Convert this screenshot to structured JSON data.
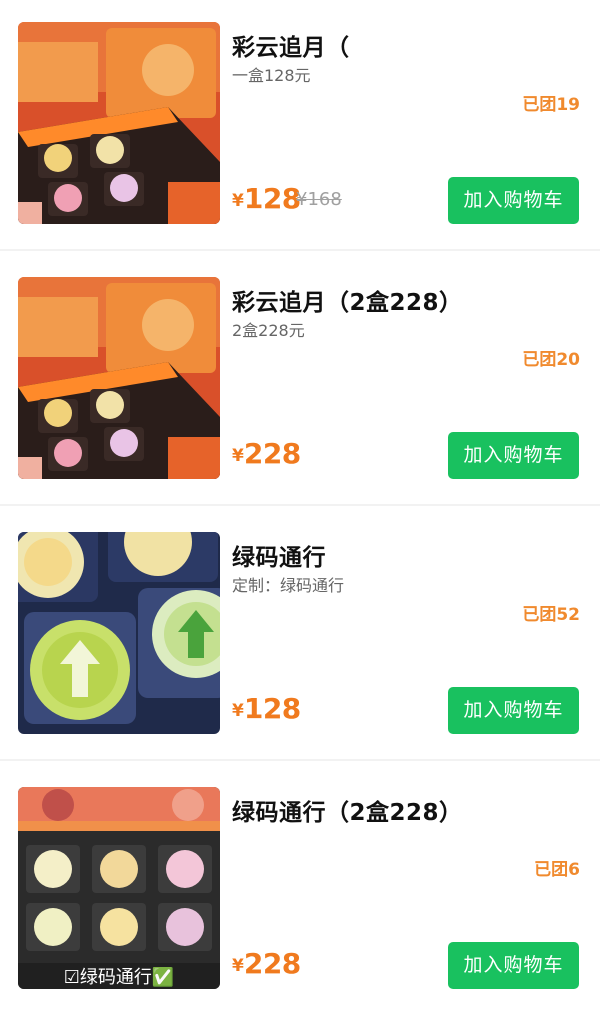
{
  "products": [
    {
      "title": "彩云追月（",
      "subtitle": "一盒128元",
      "sold": "已团19",
      "currency": "¥",
      "price": "128",
      "original_price": "¥168",
      "button_label": "加入购物车",
      "image": "orange-mooncake-gift-box"
    },
    {
      "title": "彩云追月（2盒228）",
      "subtitle": "2盒228元",
      "sold": "已团20",
      "currency": "¥",
      "price": "228",
      "button_label": "加入购物车",
      "image": "orange-mooncake-gift-box"
    },
    {
      "title": "绿码通行",
      "subtitle": "定制：绿码通行",
      "sold": "已团52",
      "currency": "¥",
      "price": "128",
      "button_label": "加入购物车",
      "image": "green-code-mooncakes"
    },
    {
      "title": "绿码通行（2盒228）",
      "subtitle": "",
      "sold": "已团6",
      "currency": "¥",
      "price": "228",
      "button_label": "加入购物车",
      "image": "green-code-mooncake-box",
      "image_caption": "☑绿码通行✅"
    }
  ],
  "colors": {
    "accent_price": "#f07a1e",
    "sold_text": "#f08a2e",
    "button_green": "#19c15f",
    "strike_grey": "#a0a0a0"
  }
}
